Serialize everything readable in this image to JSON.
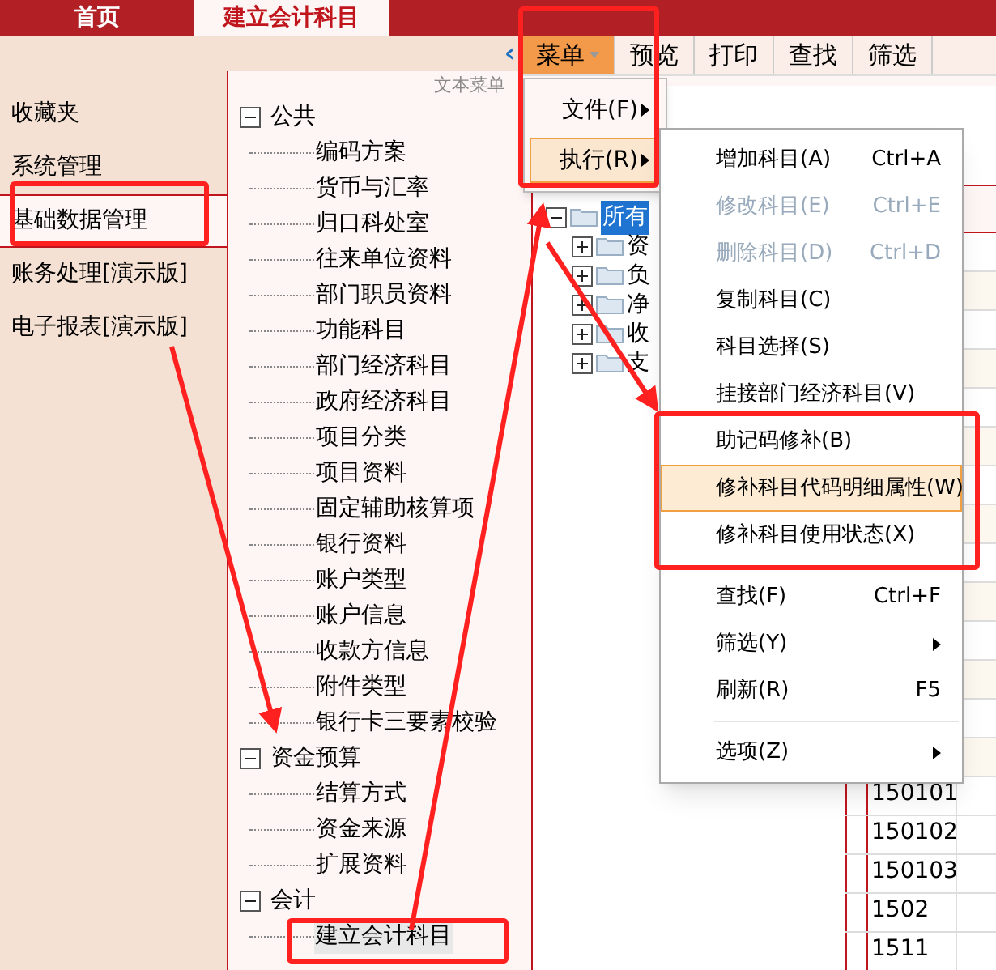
{
  "top_tabs": [
    {
      "label": "首页",
      "selected": false
    },
    {
      "label": "建立会计科目",
      "selected": true
    }
  ],
  "collapse_glyph": "‹",
  "sidebar": {
    "items": [
      {
        "label": "收藏夹",
        "selected": false
      },
      {
        "label": "系统管理",
        "selected": false
      },
      {
        "label": "基础数据管理",
        "selected": true
      },
      {
        "label": "账务处理[演示版]",
        "selected": false
      },
      {
        "label": "电子报表[演示版]",
        "selected": false
      }
    ]
  },
  "tree_panel": {
    "title": "文本菜单",
    "nodes": [
      {
        "label": "公共",
        "expanded": true,
        "selected": false,
        "children": [
          {
            "label": "编码方案",
            "selected": false
          },
          {
            "label": "货币与汇率",
            "selected": false
          },
          {
            "label": "归口科处室",
            "selected": false
          },
          {
            "label": "往来单位资料",
            "selected": false
          },
          {
            "label": "部门职员资料",
            "selected": false
          },
          {
            "label": "功能科目",
            "selected": false
          },
          {
            "label": "部门经济科目",
            "selected": false
          },
          {
            "label": "政府经济科目",
            "selected": false
          },
          {
            "label": "项目分类",
            "selected": false
          },
          {
            "label": "项目资料",
            "selected": false
          },
          {
            "label": "固定辅助核算项",
            "selected": false
          },
          {
            "label": "银行资料",
            "selected": false
          },
          {
            "label": "账户类型",
            "selected": false
          },
          {
            "label": "账户信息",
            "selected": false
          },
          {
            "label": "收款方信息",
            "selected": false
          },
          {
            "label": "附件类型",
            "selected": false
          },
          {
            "label": "银行卡三要素校验",
            "selected": false
          }
        ]
      },
      {
        "label": "资金预算",
        "expanded": true,
        "selected": false,
        "children": [
          {
            "label": "结算方式",
            "selected": false
          },
          {
            "label": "资金来源",
            "selected": false
          },
          {
            "label": "扩展资料",
            "selected": false
          }
        ]
      },
      {
        "label": "会计",
        "expanded": true,
        "selected": false,
        "children": [
          {
            "label": "建立会计科目",
            "selected": true
          }
        ]
      }
    ]
  },
  "toolbar": [
    {
      "label": "菜单",
      "selected": true,
      "dropdown": true
    },
    {
      "label": "预览",
      "selected": false,
      "dropdown": false
    },
    {
      "label": "打印",
      "selected": false,
      "dropdown": false
    },
    {
      "label": "查找",
      "selected": false,
      "dropdown": false
    },
    {
      "label": "筛选",
      "selected": false,
      "dropdown": false
    }
  ],
  "account_tree": {
    "root": {
      "label": "所有",
      "selected": true,
      "children": [
        {
          "label": "资"
        },
        {
          "label": "负"
        },
        {
          "label": "净"
        },
        {
          "label": "收"
        },
        {
          "label": "支"
        }
      ]
    }
  },
  "table": {
    "rows": [
      {
        "code": "150101"
      },
      {
        "code": "150102"
      },
      {
        "code": "150103"
      },
      {
        "code": "1502"
      },
      {
        "code": "1511"
      }
    ]
  },
  "menu": {
    "items": [
      {
        "label": "文件(F)",
        "selected": false
      },
      {
        "label": "执行(R)",
        "selected": true
      }
    ]
  },
  "submenu": {
    "items": [
      {
        "kind": "item",
        "label": "增加科目(A)",
        "shortcut": "Ctrl+A",
        "disabled": false,
        "selected": false,
        "submenu": false
      },
      {
        "kind": "item",
        "label": "修改科目(E)",
        "shortcut": "Ctrl+E",
        "disabled": true,
        "selected": false,
        "submenu": false
      },
      {
        "kind": "item",
        "label": "删除科目(D)",
        "shortcut": "Ctrl+D",
        "disabled": true,
        "selected": false,
        "submenu": false
      },
      {
        "kind": "item",
        "label": "复制科目(C)",
        "disabled": false,
        "selected": false,
        "submenu": false
      },
      {
        "kind": "item",
        "label": "科目选择(S)",
        "disabled": false,
        "selected": false,
        "submenu": false
      },
      {
        "kind": "item",
        "label": "挂接部门经济科目(V)",
        "disabled": false,
        "selected": false,
        "submenu": false
      },
      {
        "kind": "item",
        "label": "助记码修补(B)",
        "disabled": false,
        "selected": false,
        "submenu": false
      },
      {
        "kind": "item",
        "label": "修补科目代码明细属性(W)",
        "disabled": false,
        "selected": true,
        "submenu": false
      },
      {
        "kind": "item",
        "label": "修补科目使用状态(X)",
        "disabled": false,
        "selected": false,
        "submenu": false
      },
      {
        "kind": "separator"
      },
      {
        "kind": "item",
        "label": "查找(F)",
        "shortcut": "Ctrl+F",
        "disabled": false,
        "selected": false,
        "submenu": false
      },
      {
        "kind": "item",
        "label": "筛选(Y)",
        "disabled": false,
        "selected": false,
        "submenu": true
      },
      {
        "kind": "item",
        "label": "刷新(R)",
        "shortcut": "F5",
        "disabled": false,
        "selected": false,
        "submenu": false
      },
      {
        "kind": "separator"
      },
      {
        "kind": "item",
        "label": "选项(Z)",
        "disabled": false,
        "selected": false,
        "submenu": true
      }
    ]
  }
}
